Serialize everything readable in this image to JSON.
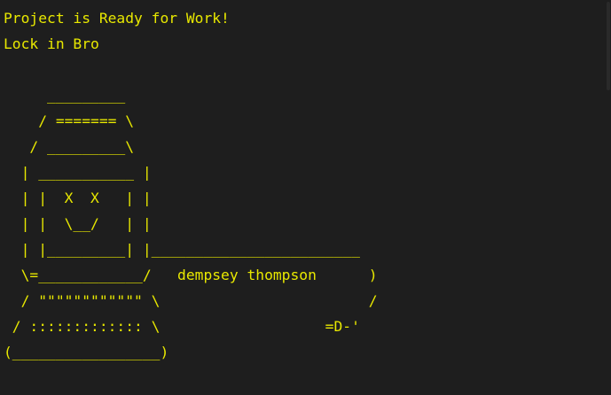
{
  "terminal": {
    "text_color": "#e8e800",
    "background_color": "#1e1e1e",
    "lines": [
      "Project is Ready for Work!",
      "Lock in Bro",
      "",
      "     _________",
      "    / ======= \\",
      "   / _________\\",
      "  | ___________ |",
      "  | |  X  X   | |",
      "  | |  \\__/   | |",
      "  | |_________| |________________________",
      "  \\=____________/   dempsey thompson      )",
      "  / \"\"\"\"\"\"\"\"\"\"\"\" \\                        /",
      " / ::::::::::::: \\                   =D-'",
      "(_________________)"
    ]
  }
}
